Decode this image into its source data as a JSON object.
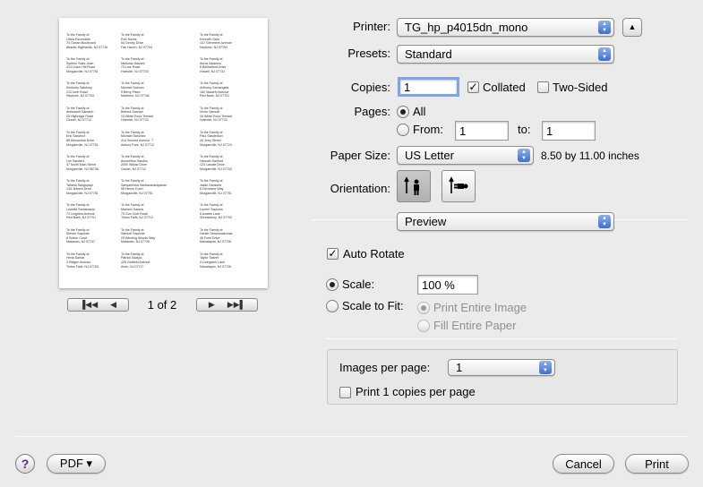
{
  "preview": {
    "addresses": [
      [
        "To the Family of:\nOlivia Escondido\n74 Ocean Boulevard\nAtlantic Highlands, NJ 07716",
        "To the Family of:\nRob Sachs\n54 Gentry Drive\nFair Haven, NJ 07704",
        "To the Family of:\nKenneth Sahr\n107 Glenmere Avenue\nNeptune, NJ 07753"
      ],
      [
        "To the Family of:\nSyeben Saint-Jean\n413 Union Hill Road\nMorganville, NJ 07751",
        "To the Family of:\nNicholas Sassen\n73 Line Road\nHolmdel, NJ 07733",
        "To the Family of:\nAlexa Salamon\n8 Bellbalford Drive\nHowell, NJ 07731"
      ],
      [
        "To the Family of:\nKimberly Salsbury\n213 Ione Road\nNeptune, NJ 07753",
        "To the Family of:\nMichael Salmon\n9 Berry Place\nMarlboro, NJ 07746",
        "To the Family of:\nAnthony Samangela\n182 Nacarth Avenue\nRed Bank, NJ 07701"
      ],
      [
        "To the Family of:\nAleksandr Samarin\n25 Highridge Road\nOcean, NJ 07712",
        "To the Family of:\nBethea Samuel\n13 White Rock Terrace\nHolmdel, NJ 07733",
        "To the Family of:\nVictor Samuel\n16 White Rock Terrace\nHolmdel, NJ 07733"
      ],
      [
        "To the Family of:\nErik Sanchez\n86 Alexandria Drive\nMorganville, NJ 07751",
        "To the Family of:\nMichael Sanchez\n414 Second Avenue, 7\nAsbury Park, NJ 07712",
        "To the Family of:\nPaul Sanderson\n45 Jerry Street\nMorganville, NJ 07724"
      ],
      [
        "To the Family of:\nLee Sanders\n47 North Main Street\nMorganville, NJ 08738",
        "To the Family of:\nAnnsellina Sandhu\n2000 Willow Drive\nOcean, NJ 07712",
        "To the Family of:\nHannah Sanford\n123 Lasalle Drive\nMorganville, NJ 07753"
      ],
      [
        "To the Family of:\nTatiana Sangupapi\n145 Jeferch Drive\nMorganville, NJ 07751",
        "To the Family of:\nSanyaminha Sankaranarayanan\n98 Heron Court\nMorganville, NJ 07751",
        "To the Family of:\nJaslin Sansone\n6 Demesne Way\nMorganville, NJ 07751"
      ],
      [
        "To the Family of:\nLowelld Santamaria\n74 Leighton Avenue\nRed Bank, NJ 07701",
        "To the Family of:\nMariano Santos\n73 Gun Club Road\nTinton Falls, NJ 07712",
        "To the Family of:\nLauren Saporsa\n6 Azalea Lane\nShrewsbury, NJ 07702"
      ],
      [
        "To the Family of:\nSteven Saponte\n6 Sutton Court\nMatawan, NJ 07747",
        "To the Family of:\nSamuel Saponte\n29 Winding Woods Way\nMatawan, NJ 07726",
        "To the Family of:\nHarish Saravanakumar\n45 Fons Drive\nManalapan, NJ 07726"
      ],
      [
        "To the Family of:\nHena Sarkar\n3 Ridgen Avenue\nTinton Falls, NJ 07753",
        "To the Family of:\nPatrick Saalya\n428 Garfield Avenue\nAvon, NJ 07717",
        "To the Family of:\nTaylor Satzer\n4 Livingston Lane\nManalapan, NJ 07726"
      ]
    ],
    "page_indicator": "1 of 2"
  },
  "printer": {
    "label": "Printer:",
    "value": "TG_hp_p4015dn_mono"
  },
  "presets": {
    "label": "Presets:",
    "value": "Standard"
  },
  "copies": {
    "label": "Copies:",
    "value": "1",
    "collated_label": "Collated",
    "collated_checked": true,
    "two_sided_label": "Two-Sided",
    "two_sided_checked": false
  },
  "pages": {
    "label": "Pages:",
    "all_label": "All",
    "from_label": "From:",
    "from_value": "1",
    "to_label": "to:",
    "to_value": "1"
  },
  "paper_size": {
    "label": "Paper Size:",
    "value": "US Letter",
    "dimensions": "8.50 by 11.00 inches"
  },
  "orientation": {
    "label": "Orientation:"
  },
  "panel": {
    "value": "Preview"
  },
  "auto_rotate": {
    "label": "Auto Rotate",
    "checked": true
  },
  "scale": {
    "label": "Scale:",
    "value": "100 %"
  },
  "scale_to_fit": {
    "label": "Scale to Fit:",
    "print_entire_image": "Print Entire Image",
    "fill_entire_paper": "Fill Entire Paper"
  },
  "images": {
    "label": "Images per page:",
    "value": "1",
    "print_copies_label": "Print 1 copies per page"
  },
  "footer": {
    "help": "?",
    "pdf": "PDF ▾",
    "cancel": "Cancel",
    "print": "Print"
  },
  "colors": {
    "accent": "#3b6fd0",
    "window_bg": "#ebebeb"
  }
}
